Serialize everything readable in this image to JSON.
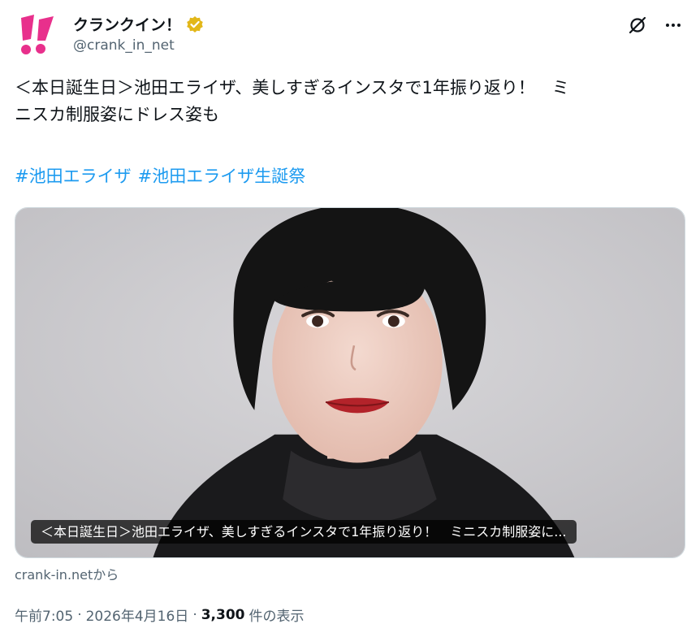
{
  "account": {
    "display_name": "クランクイン！",
    "handle": "@crank_in_net",
    "avatar_icon": "crankin-logo-icon",
    "verified_icon": "gold-verified-badge-icon",
    "brand_color": "#e8308c",
    "verified_color": "#e2b719"
  },
  "actions": {
    "grok_icon": "grok-icon",
    "more_icon": "more-horizontal-icon"
  },
  "tweet": {
    "text_line1": "＜本日誕生日＞池田エライザ、美しすぎるインスタで1年振り返り！　ミ",
    "text_line2": "ニスカ制服姿にドレス姿も",
    "hashtags": [
      "#池田エライザ",
      "#池田エライザ生誕祭"
    ]
  },
  "card": {
    "title": "＜本日誕生日＞池田エライザ、美しすぎるインスタで1年振り返り！　ミニスカ制服姿に...",
    "source": "crank-in.netから"
  },
  "meta": {
    "time": "午前7:05",
    "separator": "·",
    "date": "2026年4月16日",
    "views_count": "3,300",
    "views_label": "件の表示"
  },
  "colors": {
    "text": "#0f1419",
    "secondary": "#536471",
    "link": "#1d9bf0",
    "card_background": "#c9c8cc"
  }
}
